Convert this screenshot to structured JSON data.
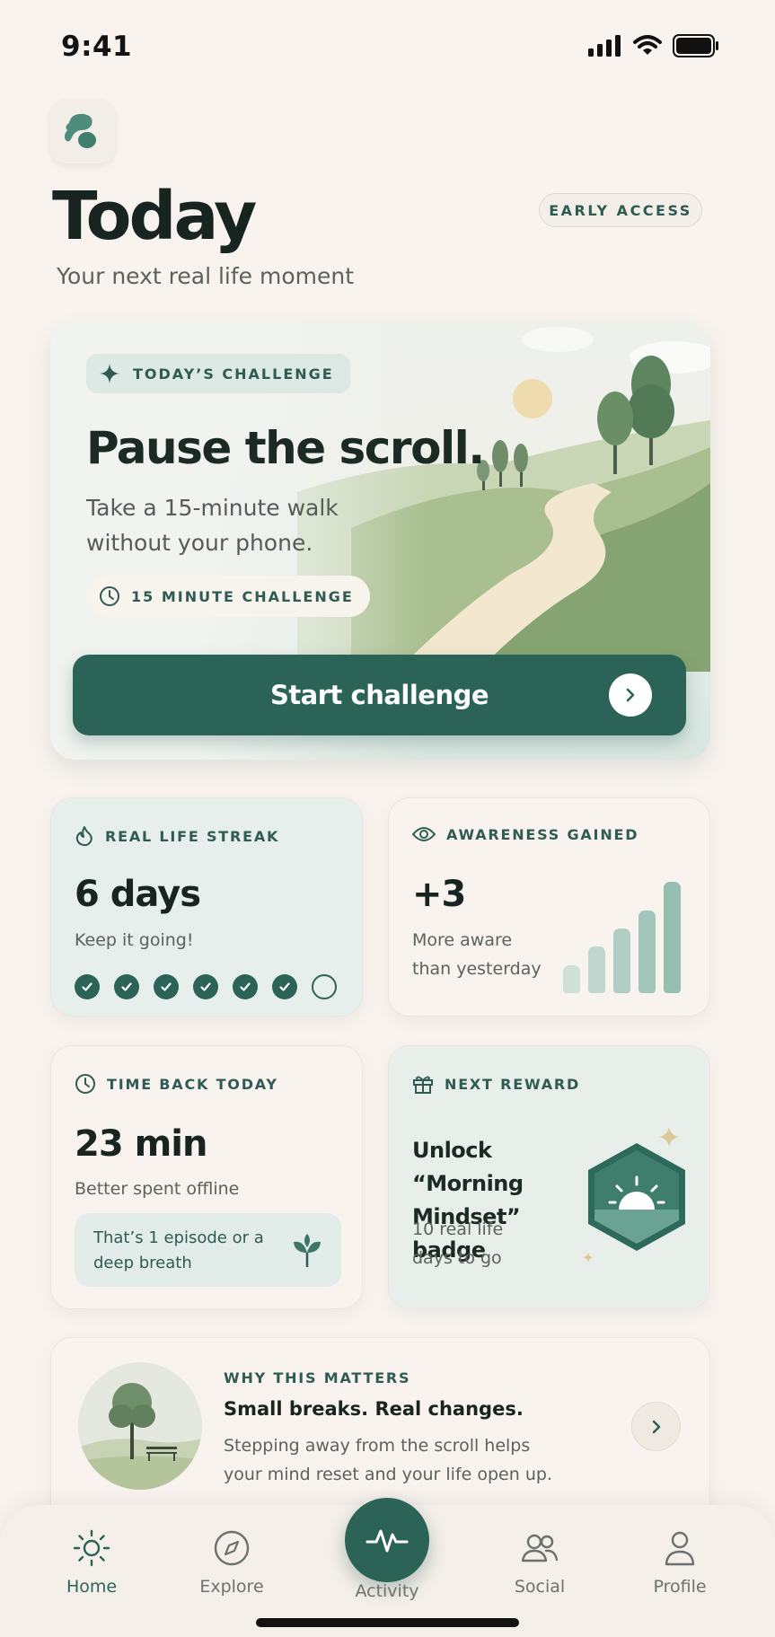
{
  "status": {
    "time": "9:41"
  },
  "header": {
    "title": "Today",
    "subtitle": "Your next real life moment",
    "badge": "EARLY ACCESS"
  },
  "challenge": {
    "tag": "TODAY’S CHALLENGE",
    "title": "Pause the scroll.",
    "description": "Take a 15-minute walk without your phone.",
    "duration_chip": "15 MINUTE CHALLENGE",
    "button_label": "Start challenge"
  },
  "streak": {
    "label": "REAL LIFE STREAK",
    "value": "6 days",
    "subtitle": "Keep it going!",
    "days_completed": 6,
    "days_total": 7
  },
  "awareness": {
    "label": "AWARENESS GAINED",
    "value": "+3",
    "subtitle": "More aware than yesterday",
    "bar_levels": [
      0.25,
      0.42,
      0.58,
      0.74,
      1.0
    ],
    "bar_colors": [
      "#cfe0d9",
      "#bfd7ce",
      "#b0cec3",
      "#a3c6ba",
      "#96bfb2"
    ]
  },
  "timeback": {
    "label": "TIME BACK TODAY",
    "value": "23 min",
    "subtitle": "Better spent offline",
    "note": "That’s 1 episode or a deep breath"
  },
  "reward": {
    "label": "NEXT REWARD",
    "title": "Unlock “Morning Mindset” badge",
    "subtitle": "10 real life days to go"
  },
  "why": {
    "label": "WHY THIS MATTERS",
    "title": "Small breaks. Real changes.",
    "description": "Stepping away from the scroll helps your mind reset and your life open up."
  },
  "tabs": [
    {
      "label": "Home",
      "icon": "sun-icon",
      "active": true
    },
    {
      "label": "Explore",
      "icon": "compass-icon",
      "active": false
    },
    {
      "label": "Activity",
      "icon": "pulse-icon",
      "active": false
    },
    {
      "label": "Social",
      "icon": "people-icon",
      "active": false
    },
    {
      "label": "Profile",
      "icon": "person-icon",
      "active": false
    }
  ],
  "colors": {
    "accent": "#2b6357",
    "background": "#f8f3ee",
    "tint": "#e6efec"
  }
}
